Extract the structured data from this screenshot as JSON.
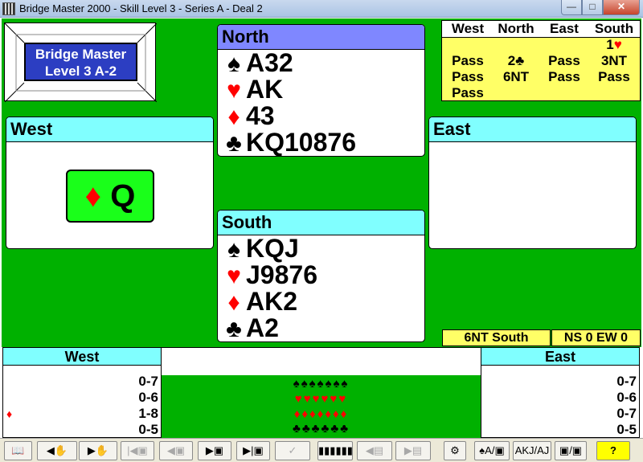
{
  "window": {
    "title": "Bridge Master 2000 - Skill Level 3 - Series A - Deal 2",
    "controls": {
      "minimize": "—",
      "maximize": "□",
      "close": "✕"
    }
  },
  "logo": {
    "line1": "Bridge Master",
    "line2": "Level 3 A-2"
  },
  "north": {
    "name": "North",
    "hand": [
      {
        "suit": "♠",
        "color": "#000000",
        "cards": "A32"
      },
      {
        "suit": "♥",
        "color": "#ff0000",
        "cards": "AK"
      },
      {
        "suit": "♦",
        "color": "#ff0000",
        "cards": "43"
      },
      {
        "suit": "♣",
        "color": "#000000",
        "cards": "KQ10876"
      }
    ]
  },
  "south": {
    "name": "South",
    "hand": [
      {
        "suit": "♠",
        "color": "#000000",
        "cards": "KQJ"
      },
      {
        "suit": "♥",
        "color": "#ff0000",
        "cards": "J9876"
      },
      {
        "suit": "♦",
        "color": "#ff0000",
        "cards": "AK2"
      },
      {
        "suit": "♣",
        "color": "#000000",
        "cards": "A2"
      }
    ]
  },
  "west": {
    "name": "West",
    "played_card": {
      "suit": "♦",
      "rank": "Q"
    }
  },
  "east": {
    "name": "East"
  },
  "bidding": {
    "headers": [
      "West",
      "North",
      "East",
      "South"
    ],
    "rows": [
      [
        "",
        "",
        "",
        "1♥"
      ],
      [
        "Pass",
        "2♣",
        "Pass",
        "3NT"
      ],
      [
        "Pass",
        "6NT",
        "Pass",
        "Pass"
      ],
      [
        "Pass",
        "",
        "",
        ""
      ]
    ]
  },
  "contract": "6NT South",
  "score": "NS 0 EW 0",
  "west_tally": {
    "title": "West",
    "rows": [
      {
        "mark": "",
        "value": "0-7"
      },
      {
        "mark": "",
        "value": "0-6"
      },
      {
        "mark": "♦",
        "value": "1-8"
      },
      {
        "mark": "",
        "value": "0-5"
      }
    ]
  },
  "east_tally": {
    "title": "East",
    "rows": [
      {
        "mark": "",
        "value": "0-7"
      },
      {
        "mark": "",
        "value": "0-6"
      },
      {
        "mark": "",
        "value": "0-7"
      },
      {
        "mark": "",
        "value": "0-5"
      }
    ]
  },
  "played_pile": [
    {
      "symbols": "♠♠♠♠♠♠♠",
      "color": "#000000"
    },
    {
      "symbols": "♥♥♥♥♥♥",
      "color": "#ff0000"
    },
    {
      "symbols": "♦♦♦♦♦♦♦",
      "color": "#ff0000"
    },
    {
      "symbols": "♣♣♣♣♣♣",
      "color": "#000000"
    }
  ],
  "toolbar": {
    "book": "📖",
    "back_hand": "◀✋",
    "forward_hand": "▶✋",
    "first_card": "|◀▣",
    "prev_card": "◀▣",
    "next_card": "▶▣",
    "last_card": "▶|▣",
    "confirm": "✓",
    "film": "▮▮▮▮▮▮",
    "prev_deal": "◀▤",
    "next_deal": "▶▤",
    "settings": "⚙",
    "spade_toggle": "♠A/▣",
    "akj": "AKJ/AJ",
    "cards_toggle": "▣/▣",
    "help": "?"
  }
}
